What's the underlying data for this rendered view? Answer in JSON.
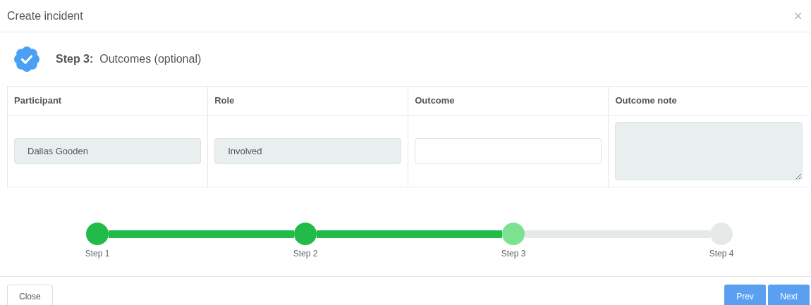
{
  "modal": {
    "title": "Create incident",
    "close_symbol": "×"
  },
  "step_heading": {
    "label": "Step 3:",
    "text": "Outcomes (optional)"
  },
  "table": {
    "columns": [
      "Participant",
      "Role",
      "Outcome",
      "Outcome note"
    ],
    "rows": [
      [
        {
          "kind": "input",
          "value": "Dallas Gooden",
          "readonly": true
        },
        {
          "kind": "input",
          "value": "Involved",
          "readonly": true
        },
        {
          "kind": "input",
          "readonly": false
        },
        {
          "kind": "textarea",
          "readonly": true
        }
      ]
    ]
  },
  "stepper": [
    {
      "label": "Step 1",
      "completed": true,
      "selected": false
    },
    {
      "label": "Step 2",
      "completed": true,
      "selected": false
    },
    {
      "label": "Step 3",
      "completed": false,
      "selected": true
    },
    {
      "label": "Step 4",
      "completed": false,
      "selected": false
    }
  ],
  "footer": {
    "close": "Close",
    "prev": "Prev",
    "next": "Next"
  }
}
